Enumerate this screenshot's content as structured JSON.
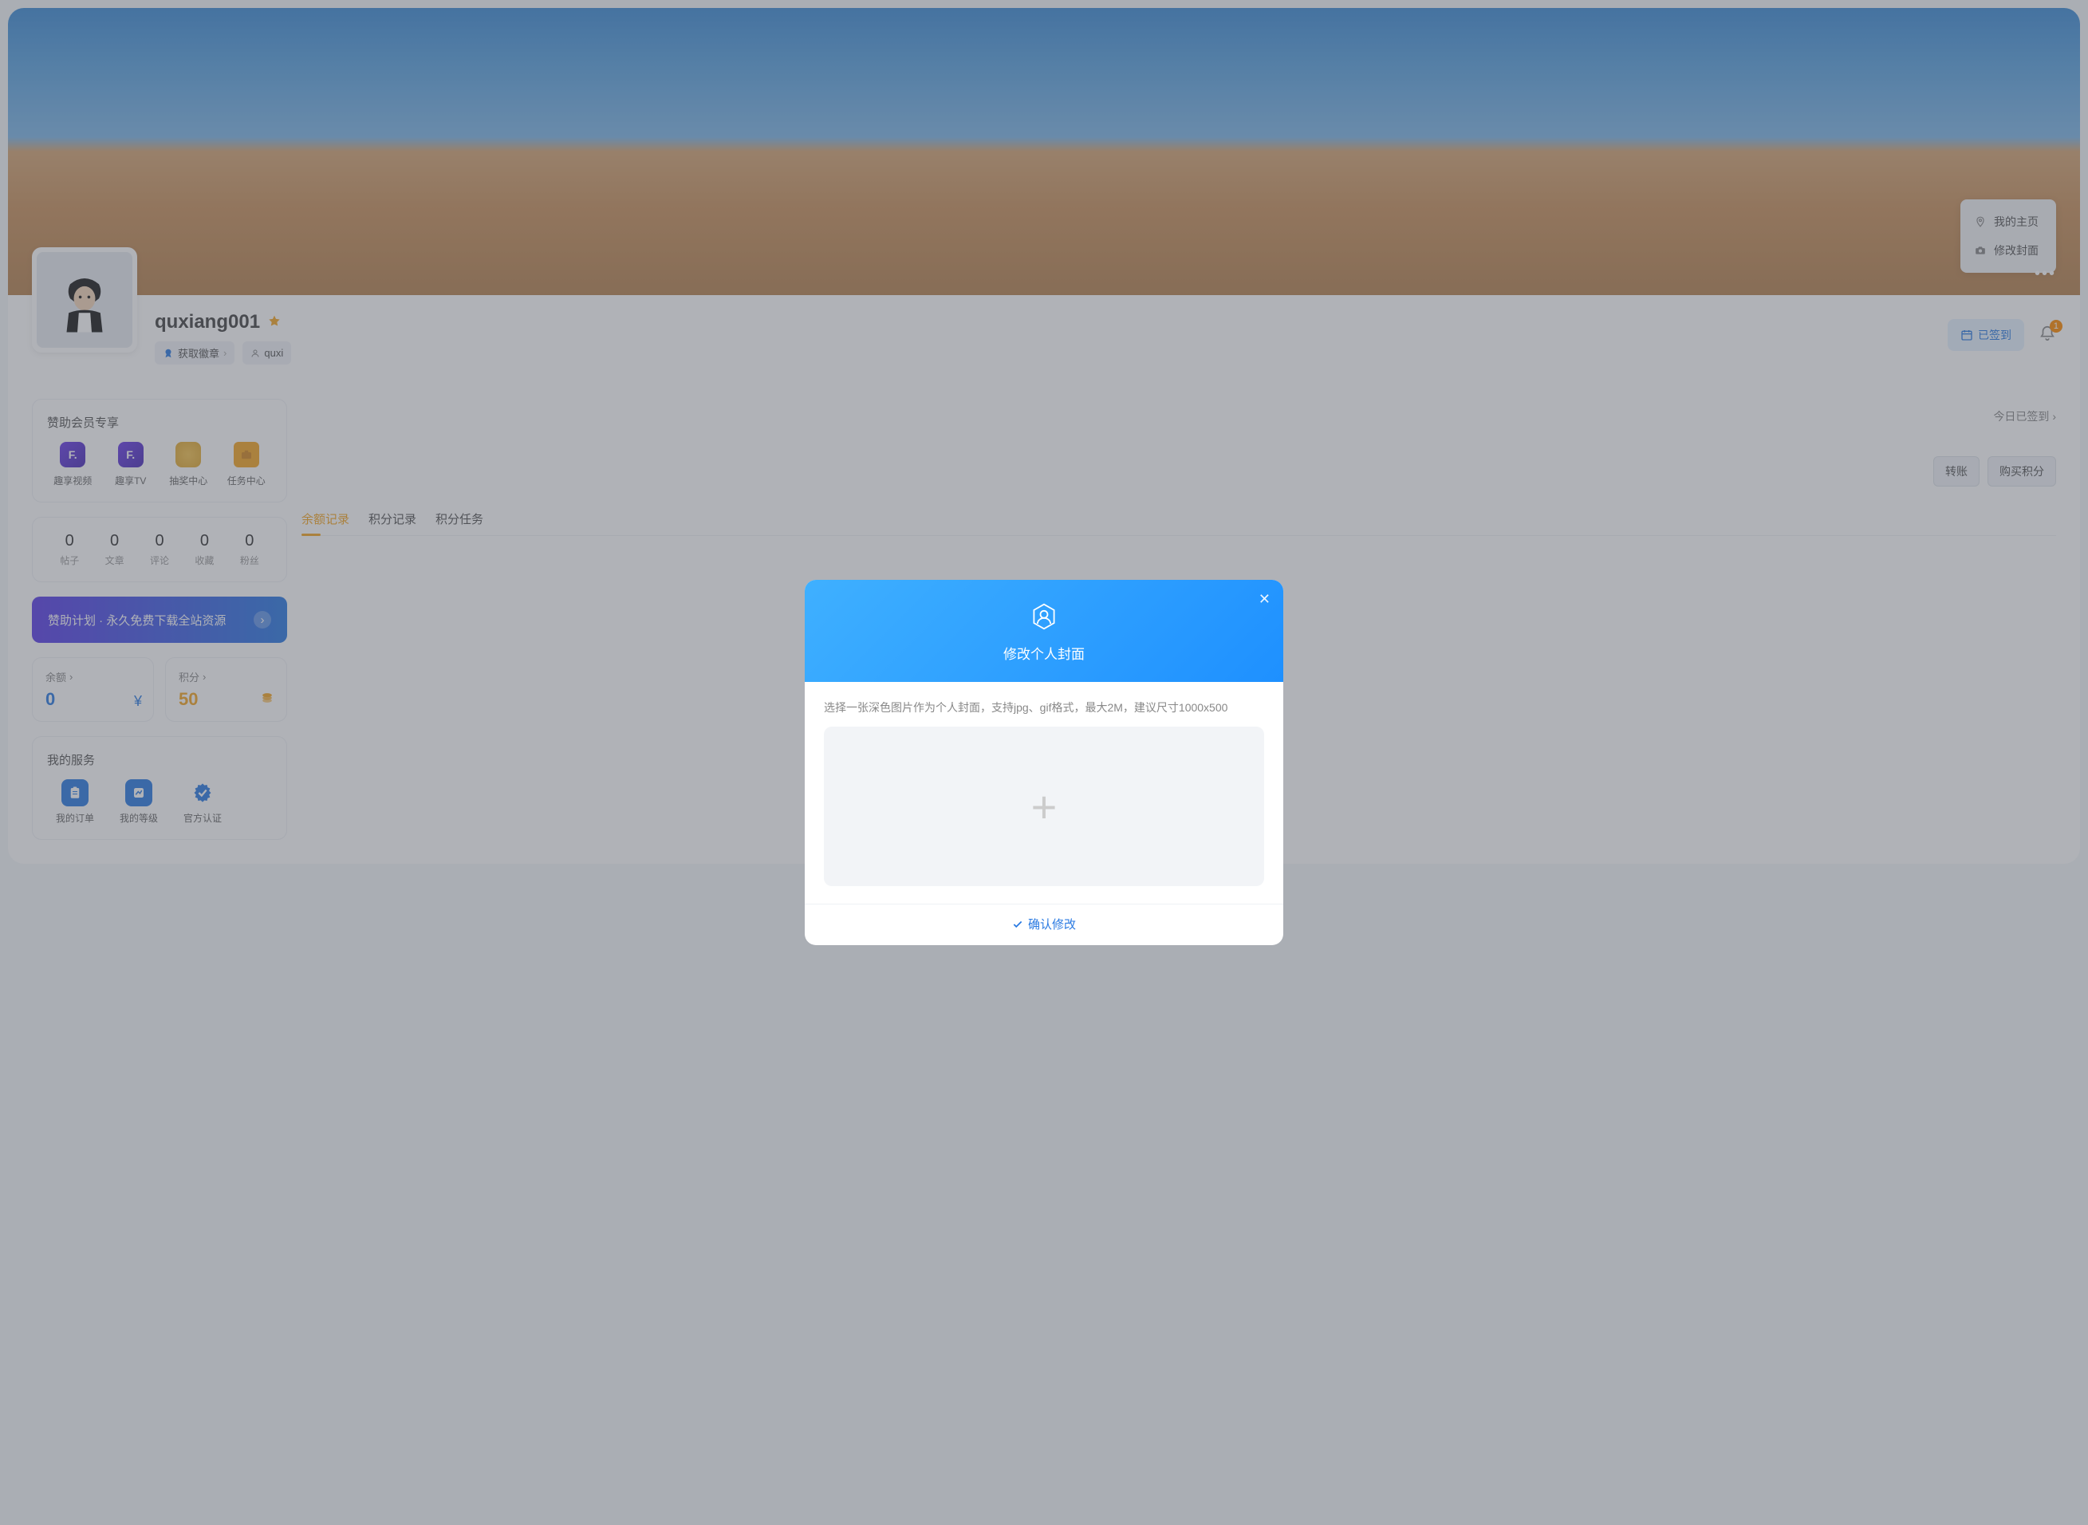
{
  "cover": {
    "dropdown": [
      {
        "key": "home",
        "label": "我的主页"
      },
      {
        "key": "cover",
        "label": "修改封面"
      }
    ]
  },
  "profile": {
    "username": "quxiang001",
    "badge_chip": "获取徽章",
    "user_chip_prefix": "quxi",
    "checkin_label": "已签到",
    "notif_count": "1"
  },
  "sidebar": {
    "member_title": "赞助会员专享",
    "member_items": [
      {
        "label": "趣享视频",
        "style": "purple",
        "glyph": "F"
      },
      {
        "label": "趣享TV",
        "style": "purple",
        "glyph": "F"
      },
      {
        "label": "抽奖中心",
        "style": "gold",
        "glyph": ""
      },
      {
        "label": "任务中心",
        "style": "orange",
        "glyph": ""
      }
    ],
    "stats": [
      {
        "num": "0",
        "label": "帖子"
      },
      {
        "num": "0",
        "label": "文章"
      },
      {
        "num": "0",
        "label": "评论"
      },
      {
        "num": "0",
        "label": "收藏"
      },
      {
        "num": "0",
        "label": "粉丝"
      }
    ],
    "sponsor_text": "赞助计划 · 永久免费下载全站资源",
    "balance": {
      "title": "余额",
      "value": "0"
    },
    "points": {
      "title": "积分",
      "value": "50"
    },
    "service_title": "我的服务",
    "services": [
      {
        "label": "我的订单"
      },
      {
        "label": "我的等级"
      },
      {
        "label": "官方认证"
      }
    ]
  },
  "right": {
    "checkin_badge": "今日已签到",
    "btn_transfer": "转账",
    "btn_buy": "购买积分",
    "tabs": [
      {
        "label": "余额记录",
        "active": true
      },
      {
        "label": "积分记录",
        "active": false
      },
      {
        "label": "积分任务",
        "active": false
      }
    ]
  },
  "modal": {
    "title": "修改个人封面",
    "hint": "选择一张深色图片作为个人封面，支持jpg、gif格式，最大2M，建议尺寸1000x500",
    "confirm": "确认修改"
  }
}
